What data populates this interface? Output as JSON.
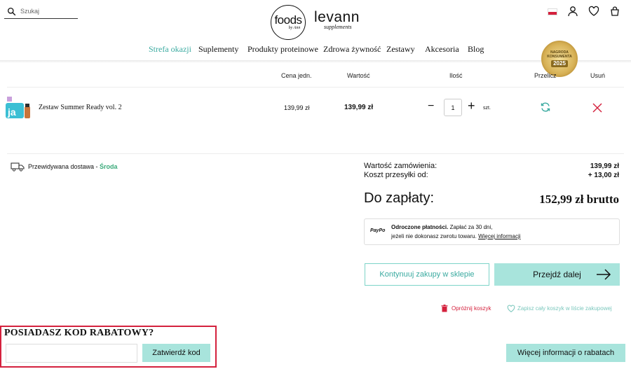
{
  "header": {
    "search_placeholder": "Szukaj",
    "logo_foods": "foods",
    "logo_foods_sub": "by Ann",
    "logo_levann": "levann",
    "logo_levann_sub": "supplements"
  },
  "nav": {
    "items": [
      {
        "label": "Strefa okazji",
        "active": true
      },
      {
        "label": "Suplementy"
      },
      {
        "label": "Produkty proteinowe"
      },
      {
        "label": "Zdrowa żywność"
      },
      {
        "label": "Zestawy"
      },
      {
        "label": "Akcesoria"
      },
      {
        "label": "Blog"
      }
    ]
  },
  "badge": {
    "line1": "NAGRODA",
    "line2": "KONSUMENTA",
    "year": "2025"
  },
  "cart": {
    "headers": {
      "unit_price": "Cena jedn.",
      "value": "Wartość",
      "quantity": "Ilość",
      "recalc": "Przelicz",
      "remove": "Usuń"
    },
    "items": [
      {
        "name": "Zestaw Summer Ready vol. 2",
        "unit_price": "139,99 zł",
        "total": "139,99 zł",
        "qty": "1",
        "unit": "szt."
      }
    ]
  },
  "delivery": {
    "label": "Przewidywana dostawa - ",
    "day": "Środa"
  },
  "summary": {
    "order_value_label": "Wartość zamówienia:",
    "order_value": "139,99 zł",
    "shipping_label": "Koszt przesyłki od:",
    "shipping_value": "+ 13,00 zł",
    "to_pay_label": "Do zapłaty:",
    "to_pay_value": "152,99 zł brutto"
  },
  "paypo": {
    "logo": "PayPo",
    "title": "Odroczone płatności.",
    "line1_rest": " Zapłać za 30 dni,",
    "line2": "jeżeli nie dokonasz zwrotu towaru. ",
    "link": "Więcej informacji"
  },
  "actions": {
    "continue": "Kontynuuj zakupy w sklepie",
    "next": "Przejdź dalej",
    "clear_cart": "Opróżnij koszyk",
    "save_cart": "Zapisz cały koszyk w liście zakupowej"
  },
  "discount": {
    "title": "POSIADASZ KOD RABATOWY?",
    "input_value": "",
    "apply": "Zatwierdź kod",
    "more_info": "Więcej informacji o rabatach"
  },
  "colors": {
    "accent": "#3aaaa0",
    "button_bg": "#a8e4dc",
    "danger": "#d4213d"
  }
}
